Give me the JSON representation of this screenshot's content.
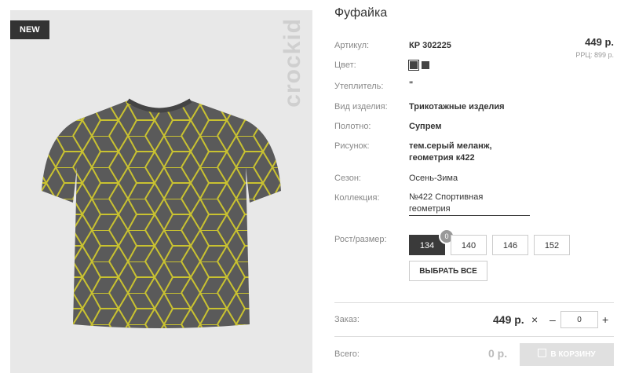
{
  "product": {
    "badge": "NEW",
    "brand": "crockid",
    "title": "Фуфайка",
    "price": "449 р.",
    "rrp": "РРЦ: 899 р."
  },
  "specs": [
    {
      "label": "Артикул:",
      "value": "КР 302225"
    },
    {
      "label": "Цвет:",
      "value": ""
    },
    {
      "label": "Утеплитель:",
      "value": "\""
    },
    {
      "label": "Вид изделия:",
      "value": "Трикотажные изделия"
    },
    {
      "label": "Полотно:",
      "value": "Супрем"
    },
    {
      "label": "Рисунок:",
      "value": "тем.серый меланж,\nгеометрия к422"
    },
    {
      "label": "Сезон:",
      "value": "Осень-Зима"
    },
    {
      "label": "Коллекция:",
      "value": "№422 Спортивная\nгеометрия"
    }
  ],
  "swatches": {
    "colors": [
      "#444444",
      "#444444"
    ]
  },
  "sizes": {
    "label": "Рост/размер:",
    "options": [
      "134",
      "140",
      "146",
      "152"
    ],
    "selected": "134",
    "count_badge": "0",
    "select_all": "ВЫБРАТЬ ВСЕ"
  },
  "order": {
    "label": "Заказ:",
    "price": "449 р.",
    "remove_icon": "×",
    "minus": "–",
    "qty": "0",
    "plus": "+"
  },
  "total": {
    "label": "Всего:",
    "value": "0 р.",
    "cart_button": "В КОРЗИНУ",
    "cart_icon": "bag-icon"
  },
  "colors": {
    "accent": "#3a3a3a",
    "shirt": "#5a5a5a",
    "pattern": "#c9c230"
  }
}
